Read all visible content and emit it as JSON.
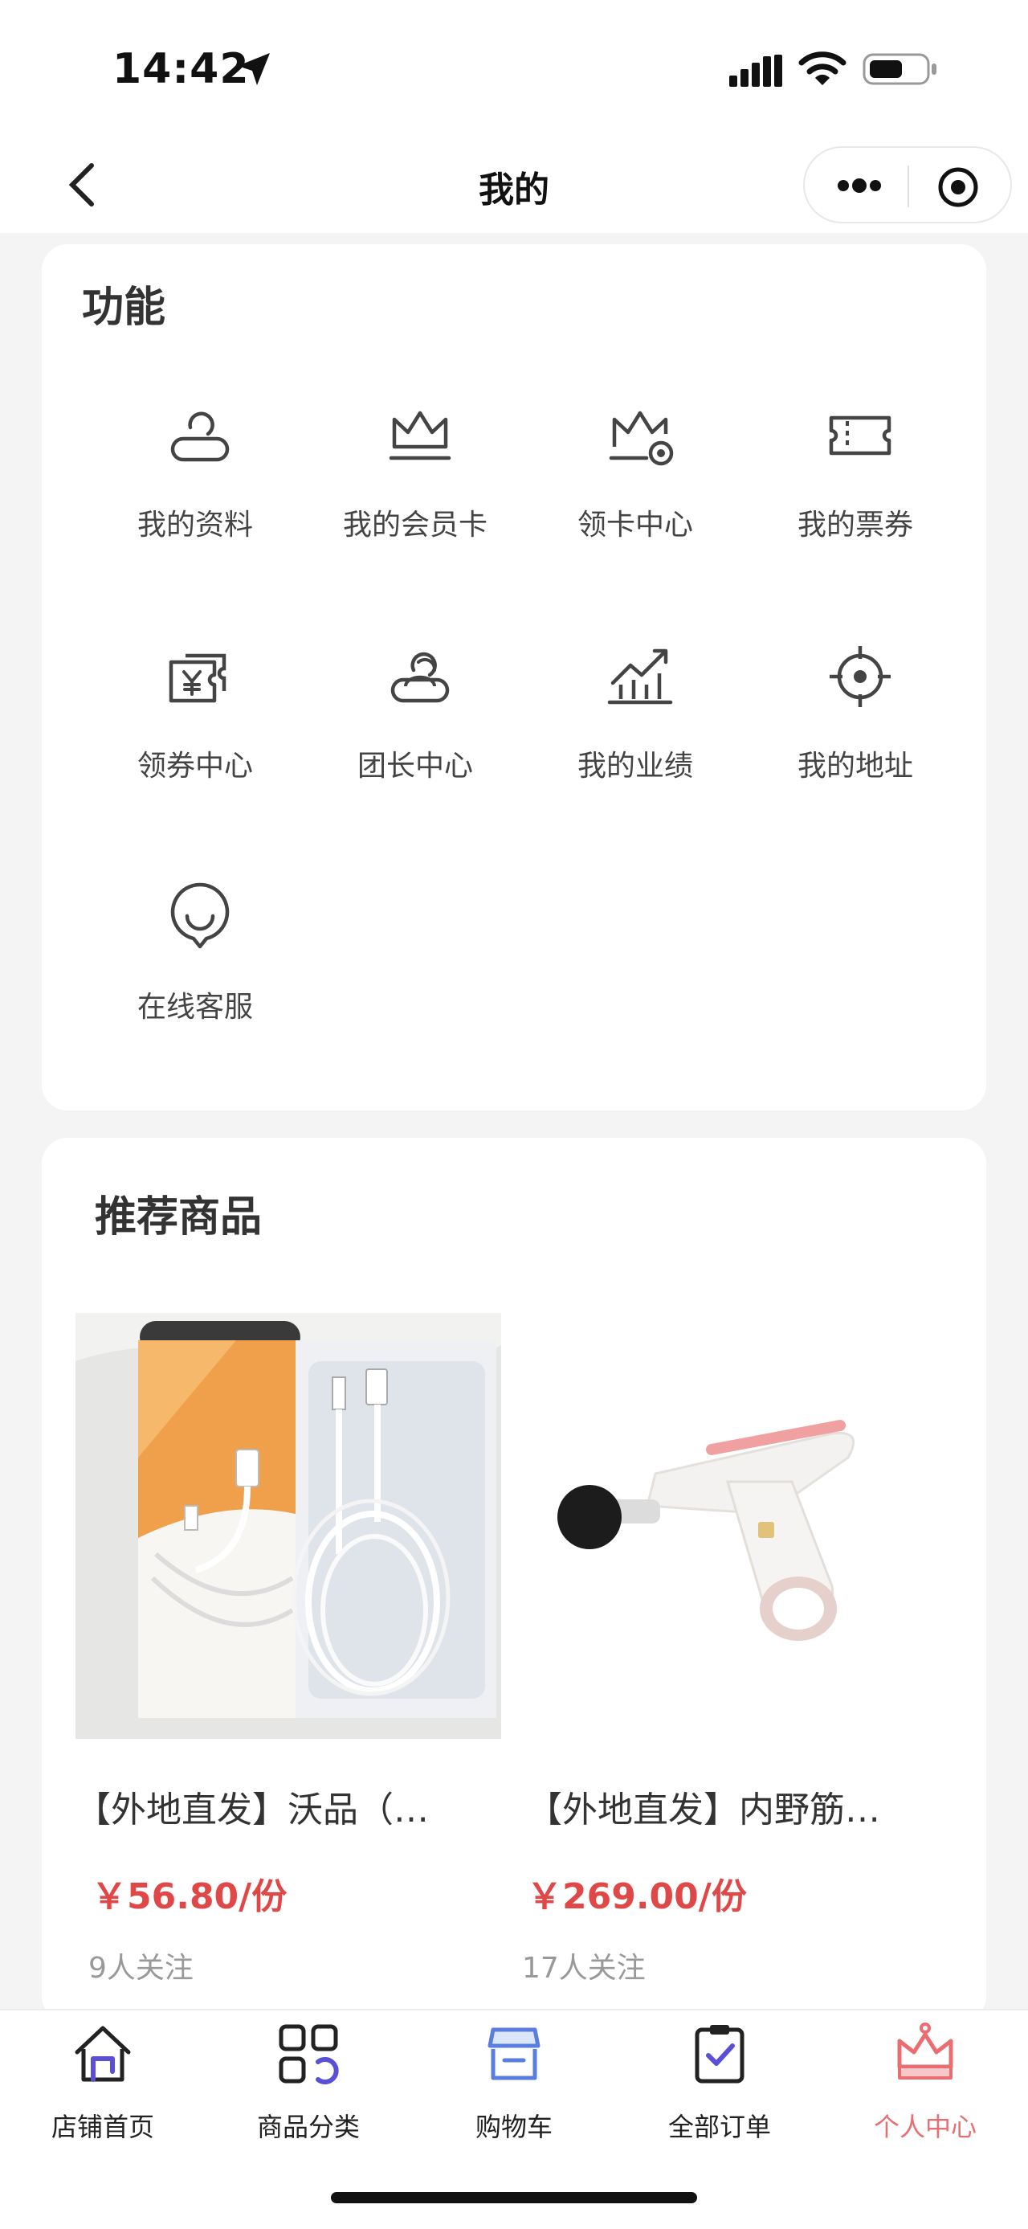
{
  "status": {
    "time": "14:42"
  },
  "nav": {
    "title": "我的"
  },
  "functions": {
    "title": "功能",
    "items": [
      {
        "label": "我的资料",
        "icon": "profile-icon"
      },
      {
        "label": "我的会员卡",
        "icon": "crown-icon"
      },
      {
        "label": "领卡中心",
        "icon": "crown-badge-icon"
      },
      {
        "label": "我的票券",
        "icon": "ticket-icon"
      },
      {
        "label": "领券中心",
        "icon": "coupon-yen-icon"
      },
      {
        "label": "团长中心",
        "icon": "leader-icon"
      },
      {
        "label": "我的业绩",
        "icon": "growth-chart-icon"
      },
      {
        "label": "我的地址",
        "icon": "location-target-icon"
      },
      {
        "label": "在线客服",
        "icon": "chat-smile-icon"
      }
    ]
  },
  "recommended": {
    "title": "推荐商品",
    "products": [
      {
        "name": "【外地直发】沃品（…",
        "price": "￥56.80/份",
        "followers": "9人关注"
      },
      {
        "name": "【外地直发】内野筋…",
        "price": "￥269.00/份",
        "followers": "17人关注"
      }
    ]
  },
  "tabbar": {
    "active_color": "#e86e72",
    "items": [
      {
        "label": "店铺首页",
        "icon": "home-icon"
      },
      {
        "label": "商品分类",
        "icon": "category-grid-icon"
      },
      {
        "label": "购物车",
        "icon": "shop-cart-icon"
      },
      {
        "label": "全部订单",
        "icon": "order-clipboard-icon"
      },
      {
        "label": "个人中心",
        "icon": "crown-profile-icon",
        "active": true
      }
    ]
  }
}
